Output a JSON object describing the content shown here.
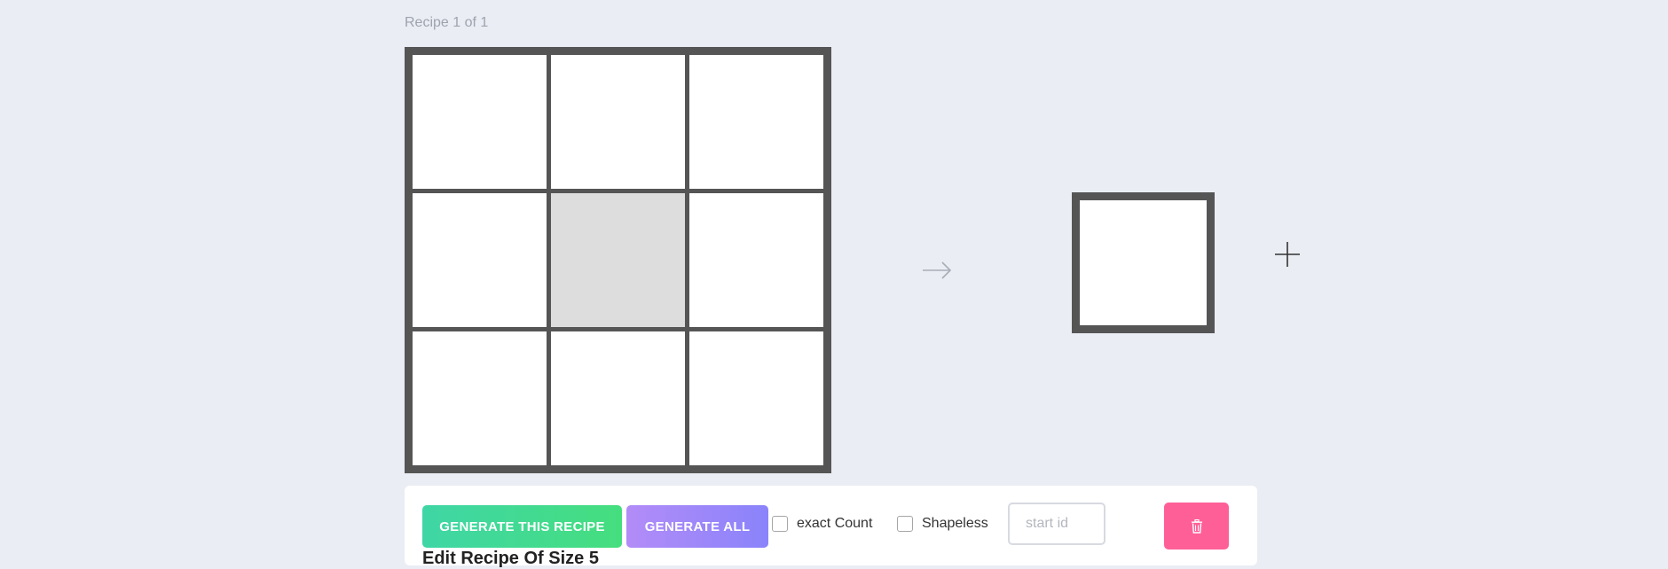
{
  "header": {
    "recipe_counter": "Recipe 1 of 1"
  },
  "crafting_grid": {
    "slots": [
      "",
      "",
      "",
      "",
      "",
      "",
      "",
      "",
      ""
    ],
    "selected_slot": 4
  },
  "icons": {
    "arrow": "arrow-right-icon",
    "add": "plus-icon",
    "delete": "trash-icon"
  },
  "controls": {
    "generate_this_label": "GENERATE THIS RECIPE",
    "generate_all_label": "GENERATE ALL",
    "exact_count_label": "exact Count",
    "exact_count_checked": false,
    "shapeless_label": "Shapeless",
    "shapeless_checked": false,
    "start_id_placeholder": "start id",
    "start_id_value": ""
  },
  "footer": {
    "partial_text": "Edit Recipe Of Size 5"
  },
  "colors": {
    "background": "#eaedf4",
    "grid_frame": "#555555",
    "selected_slot": "#dddddd",
    "generate_gradient": [
      "#3fd6a6",
      "#45de7e"
    ],
    "generate_all_gradient": [
      "#b28cf7",
      "#8a83fb"
    ],
    "delete": "#ff5f97"
  }
}
